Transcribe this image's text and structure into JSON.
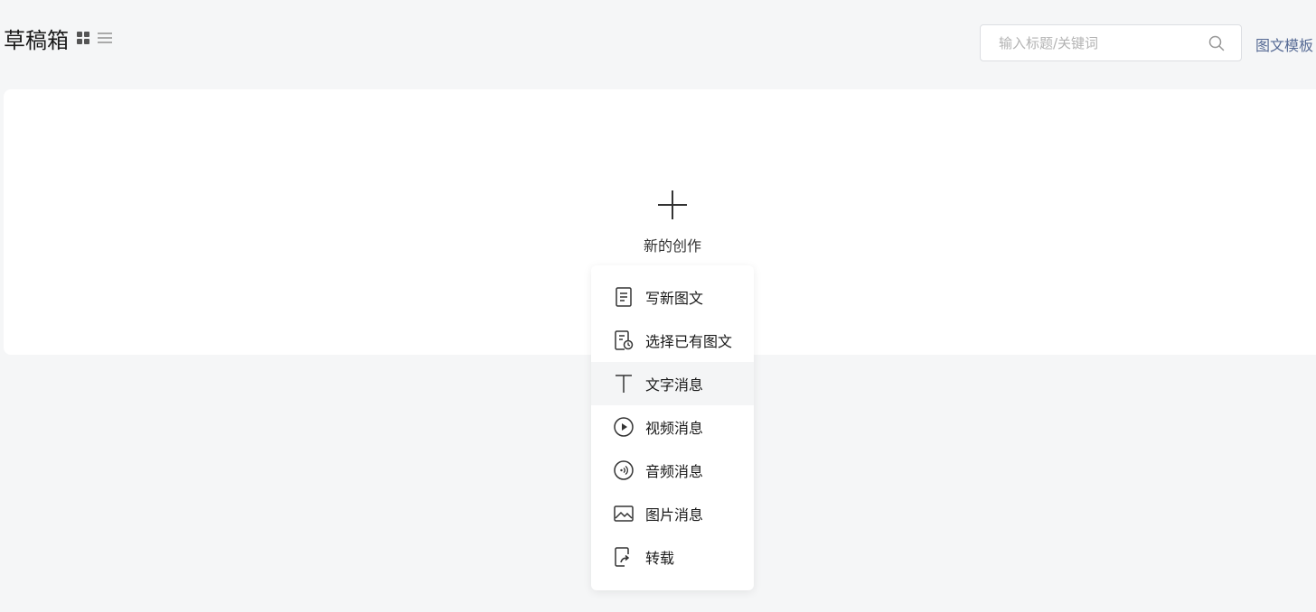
{
  "header": {
    "title": "草稿箱",
    "view_icons": [
      "grid-view-icon",
      "list-view-icon"
    ]
  },
  "search": {
    "placeholder": "输入标题/关键词",
    "value": "",
    "icon": "search-icon"
  },
  "template_link": "图文模板",
  "create": {
    "label": "新的创作",
    "icon": "plus-icon"
  },
  "menu": {
    "items": [
      {
        "label": "写新图文",
        "icon": "document-icon"
      },
      {
        "label": "选择已有图文",
        "icon": "document-clock-icon"
      },
      {
        "label": "文字消息",
        "icon": "text-icon"
      },
      {
        "label": "视频消息",
        "icon": "play-circle-icon"
      },
      {
        "label": "音频消息",
        "icon": "audio-circle-icon"
      },
      {
        "label": "图片消息",
        "icon": "image-icon"
      },
      {
        "label": "转载",
        "icon": "share-icon"
      }
    ],
    "highlighted_index": 2
  },
  "colors": {
    "background": "#f5f6f7",
    "card": "#ffffff",
    "link": "#576b95",
    "menu_hover": "#f4f5f6"
  }
}
